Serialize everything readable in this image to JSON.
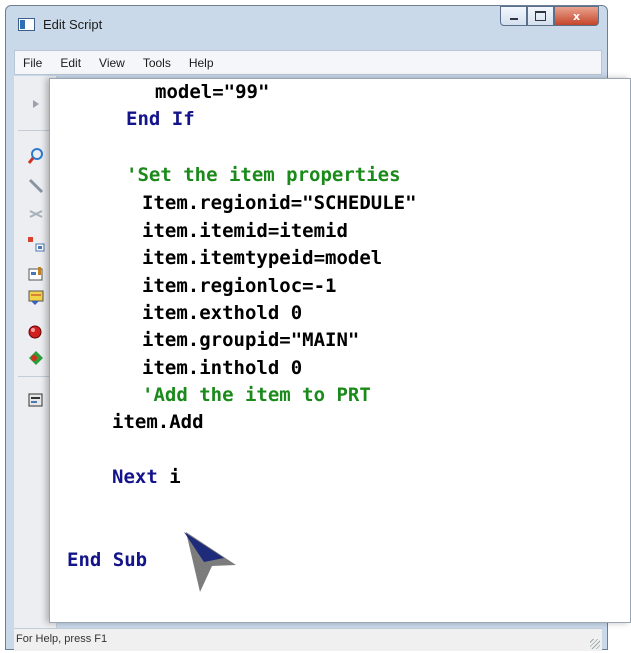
{
  "window": {
    "title": "Edit Script",
    "buttons": {
      "minimize": "minimize",
      "maximize": "maximize",
      "close": "x"
    }
  },
  "menubar": {
    "items": [
      {
        "label": "File"
      },
      {
        "label": "Edit"
      },
      {
        "label": "View"
      },
      {
        "label": "Tools"
      },
      {
        "label": "Help"
      }
    ]
  },
  "toolbar": {
    "icons": [
      "arrow-icon",
      "find-icon",
      "wand-icon",
      "cut-icon",
      "tree-icon",
      "edit-icon",
      "note-icon",
      "record-icon",
      "diamond-icon",
      "script-icon"
    ]
  },
  "code": {
    "lines": [
      {
        "text": "model=\"99\"",
        "type": "text"
      },
      {
        "text": "End If",
        "type": "keyword"
      },
      {
        "text": "",
        "type": "text"
      },
      {
        "text": "'Set the item properties",
        "type": "comment"
      },
      {
        "text": "Item.regionid=\"SCHEDULE\"",
        "type": "text"
      },
      {
        "text": "item.itemid=itemid",
        "type": "text"
      },
      {
        "text": "item.itemtypeid=model",
        "type": "text"
      },
      {
        "text": "item.regionloc=-1",
        "type": "text"
      },
      {
        "text": "item.exthold 0",
        "type": "text"
      },
      {
        "text": "item.groupid=\"MAIN\"",
        "type": "text"
      },
      {
        "text": "item.inthold 0",
        "type": "text"
      },
      {
        "text": "'Add the item to PRT",
        "type": "comment"
      },
      {
        "text": "item.Add",
        "type": "text"
      },
      {
        "text": "",
        "type": "text"
      },
      {
        "next_kw": "Next",
        "next_var": " i"
      },
      {
        "text": "",
        "type": "text"
      },
      {
        "text": "",
        "type": "text"
      },
      {
        "text": "End Sub",
        "type": "keyword"
      }
    ]
  },
  "status": {
    "text": "For Help, press F1"
  },
  "colors": {
    "keyword": "#14148a",
    "comment": "#1a8a1a",
    "text": "#000000"
  }
}
